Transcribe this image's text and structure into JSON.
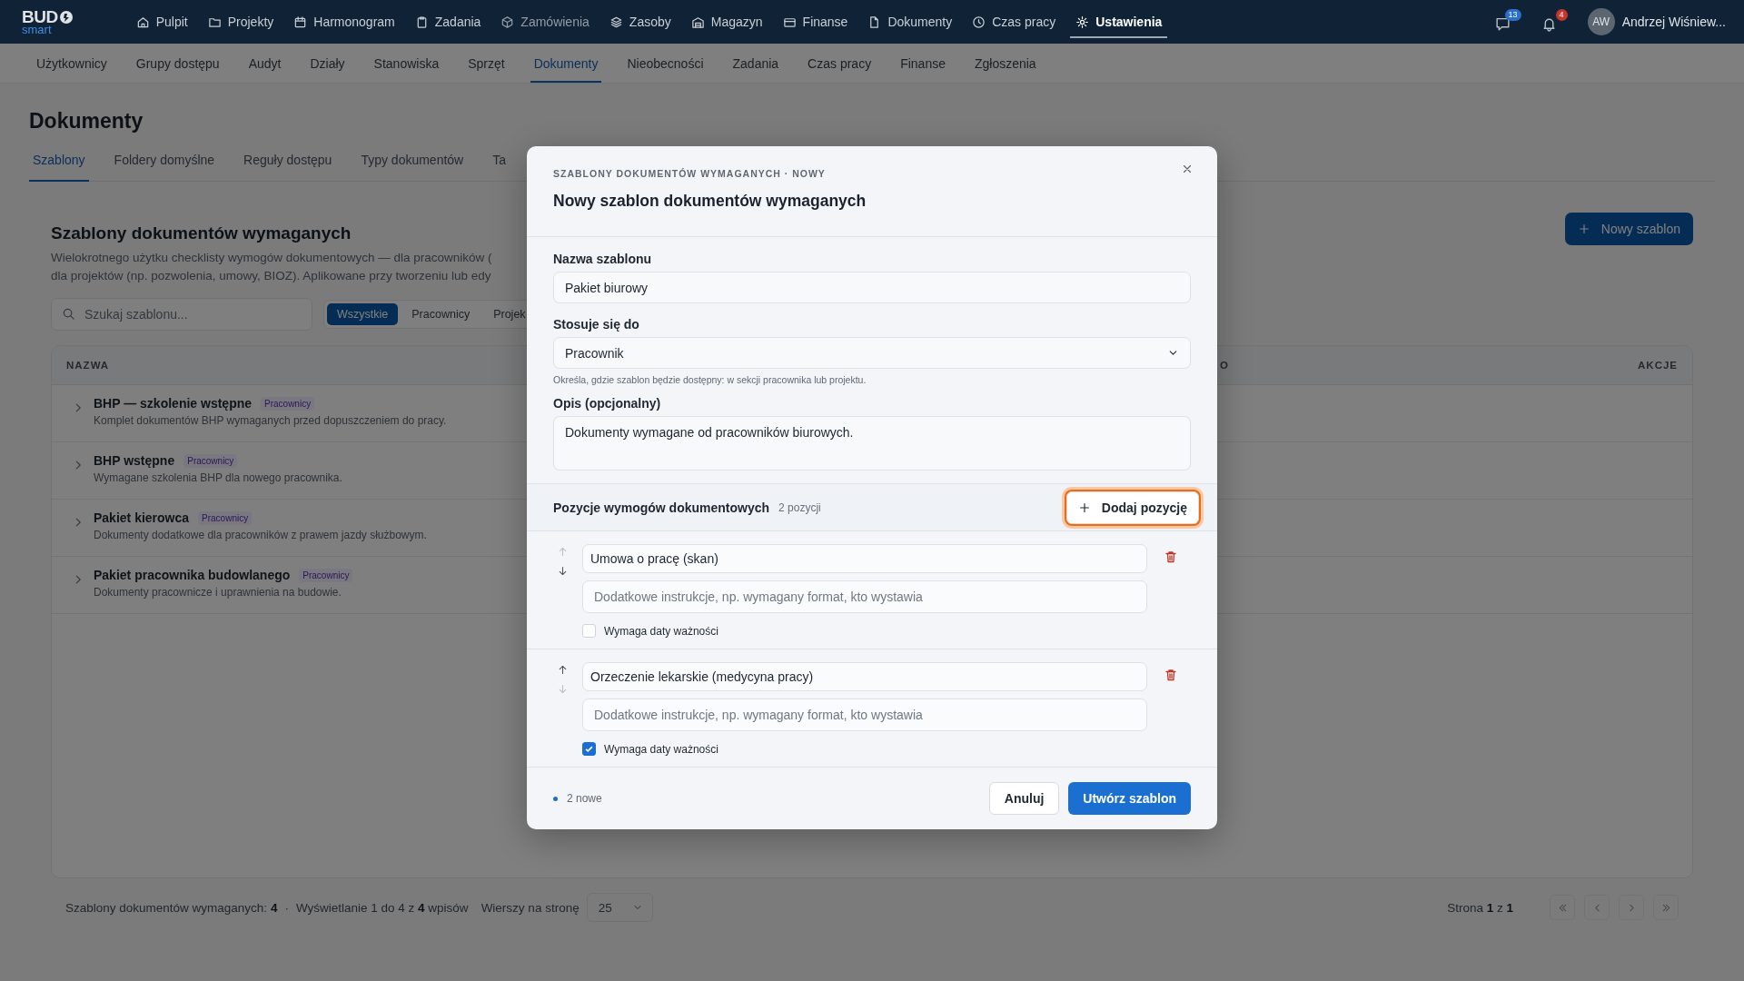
{
  "app": {
    "logo": "BUD",
    "logo_sub": "smart"
  },
  "top_nav": [
    {
      "label": "Pulpit",
      "selected": false,
      "disabled": false
    },
    {
      "label": "Projekty",
      "selected": false,
      "disabled": false
    },
    {
      "label": "Harmonogram",
      "selected": false,
      "disabled": false
    },
    {
      "label": "Zadania",
      "selected": false,
      "disabled": false
    },
    {
      "label": "Zamówienia",
      "selected": false,
      "disabled": true
    },
    {
      "label": "Zasoby",
      "selected": false,
      "disabled": false
    },
    {
      "label": "Magazyn",
      "selected": false,
      "disabled": false
    },
    {
      "label": "Finanse",
      "selected": false,
      "disabled": false
    },
    {
      "label": "Dokumenty",
      "selected": false,
      "disabled": false
    },
    {
      "label": "Czas pracy",
      "selected": false,
      "disabled": false
    },
    {
      "label": "Ustawienia",
      "selected": true,
      "disabled": false
    }
  ],
  "notifications": [
    {
      "kind": "messages",
      "count": "13"
    },
    {
      "kind": "alerts",
      "count": "4"
    }
  ],
  "user": {
    "initials": "AW",
    "name": "Andrzej Wiśniew..."
  },
  "sub_nav": [
    {
      "label": "Użytkownicy",
      "selected": false
    },
    {
      "label": "Grupy dostępu",
      "selected": false
    },
    {
      "label": "Audyt",
      "selected": false
    },
    {
      "label": "Działy",
      "selected": false
    },
    {
      "label": "Stanowiska",
      "selected": false
    },
    {
      "label": "Sprzęt",
      "selected": false
    },
    {
      "label": "Dokumenty",
      "selected": true
    },
    {
      "label": "Nieobecności",
      "selected": false
    },
    {
      "label": "Zadania",
      "selected": false
    },
    {
      "label": "Czas pracy",
      "selected": false
    },
    {
      "label": "Finanse",
      "selected": false
    },
    {
      "label": "Zgłoszenia",
      "selected": false
    }
  ],
  "page": {
    "title": "Dokumenty",
    "tabs": [
      {
        "label": "Szablony",
        "selected": true
      },
      {
        "label": "Foldery domyślne",
        "selected": false
      },
      {
        "label": "Reguły dostępu",
        "selected": false
      },
      {
        "label": "Typy dokumentów",
        "selected": false
      },
      {
        "label": "Ta",
        "selected": false
      }
    ]
  },
  "section": {
    "title": "Szablony dokumentów wymaganych",
    "description_lines": [
      "Wielokrotnego użytku checklisty wymogów dokumentowych — dla pracowników (",
      "dla projektów (np. pozwolenia, umowy, BIOZ). Aplikowane przy tworzeniu lub edy"
    ],
    "new_button": "Nowy szablon",
    "search": {
      "placeholder": "Szukaj szablonu..."
    },
    "filters": [
      {
        "label": "Wszystkie",
        "selected": true
      },
      {
        "label": "Pracownicy",
        "selected": false
      },
      {
        "label": "Projek",
        "selected": false
      }
    ],
    "table": {
      "columns": [
        "NAZWA",
        "O",
        "AKCJE"
      ],
      "rows": [
        {
          "name": "BHP — szkolenie wstępne",
          "tag": "Pracownicy",
          "description": "Komplet dokumentów BHP wymaganych przed dopuszczeniem do pracy."
        },
        {
          "name": "BHP wstępne",
          "tag": "Pracownicy",
          "description": "Wymagane szkolenia BHP dla nowego pracownika."
        },
        {
          "name": "Pakiet kierowca",
          "tag": "Pracownicy",
          "description": "Dokumenty dodatkowe dla pracowników z prawem jazdy służbowym."
        },
        {
          "name": "Pakiet pracownika budowlanego",
          "tag": "Pracownicy",
          "description": "Dokumenty pracownicze i uprawnienia na budowie."
        }
      ]
    },
    "footer": {
      "summary": "Szablony dokumentów wymaganych: **4**",
      "separator": "·",
      "showing": "Wyświetlanie 1 do 4 z **4** wpisów",
      "rows_label": "Wierszy na stronę",
      "rows_value": "25",
      "page": "Strona **1** z **1**"
    }
  },
  "modal": {
    "eyebrow": "SZABLONY DOKUMENTÓW WYMAGANYCH · NOWY",
    "title": "Nowy szablon dokumentów wymaganych",
    "name_label": "Nazwa szablonu",
    "name_value": "Pakiet biurowy",
    "applies_label": "Stosuje się do",
    "applies_value": "Pracownik",
    "applies_hint": "Określa, gdzie szablon będzie dostępny: w sekcji pracownika lub projektu.",
    "description_label": "Opis (opcjonalny)",
    "description_value": "Dokumenty wymagane od pracowników biurowych.",
    "items_title": "Pozycje wymogów dokumentowych",
    "items_count": "2 pozycji",
    "add_button": {
      "label": "Dodaj pozycję",
      "focused": true
    },
    "items": [
      {
        "name": "Umowa o pracę (skan)",
        "placeholder": "Dodatkowe instrukcje, np. wymagany format, kto wystawia",
        "requires_expiry": false,
        "expiry_label": "Wymaga daty ważności",
        "up_disabled": true,
        "down_disabled": false
      },
      {
        "name": "Orzeczenie lekarskie (medycyna pracy)",
        "placeholder": "Dodatkowe instrukcje, np. wymagany format, kto wystawia",
        "requires_expiry": true,
        "expiry_label": "Wymaga daty ważności",
        "up_disabled": false,
        "down_disabled": true
      }
    ],
    "status": "2 nowe",
    "cancel": "Anuluj",
    "submit": "Utwórz szablon"
  }
}
